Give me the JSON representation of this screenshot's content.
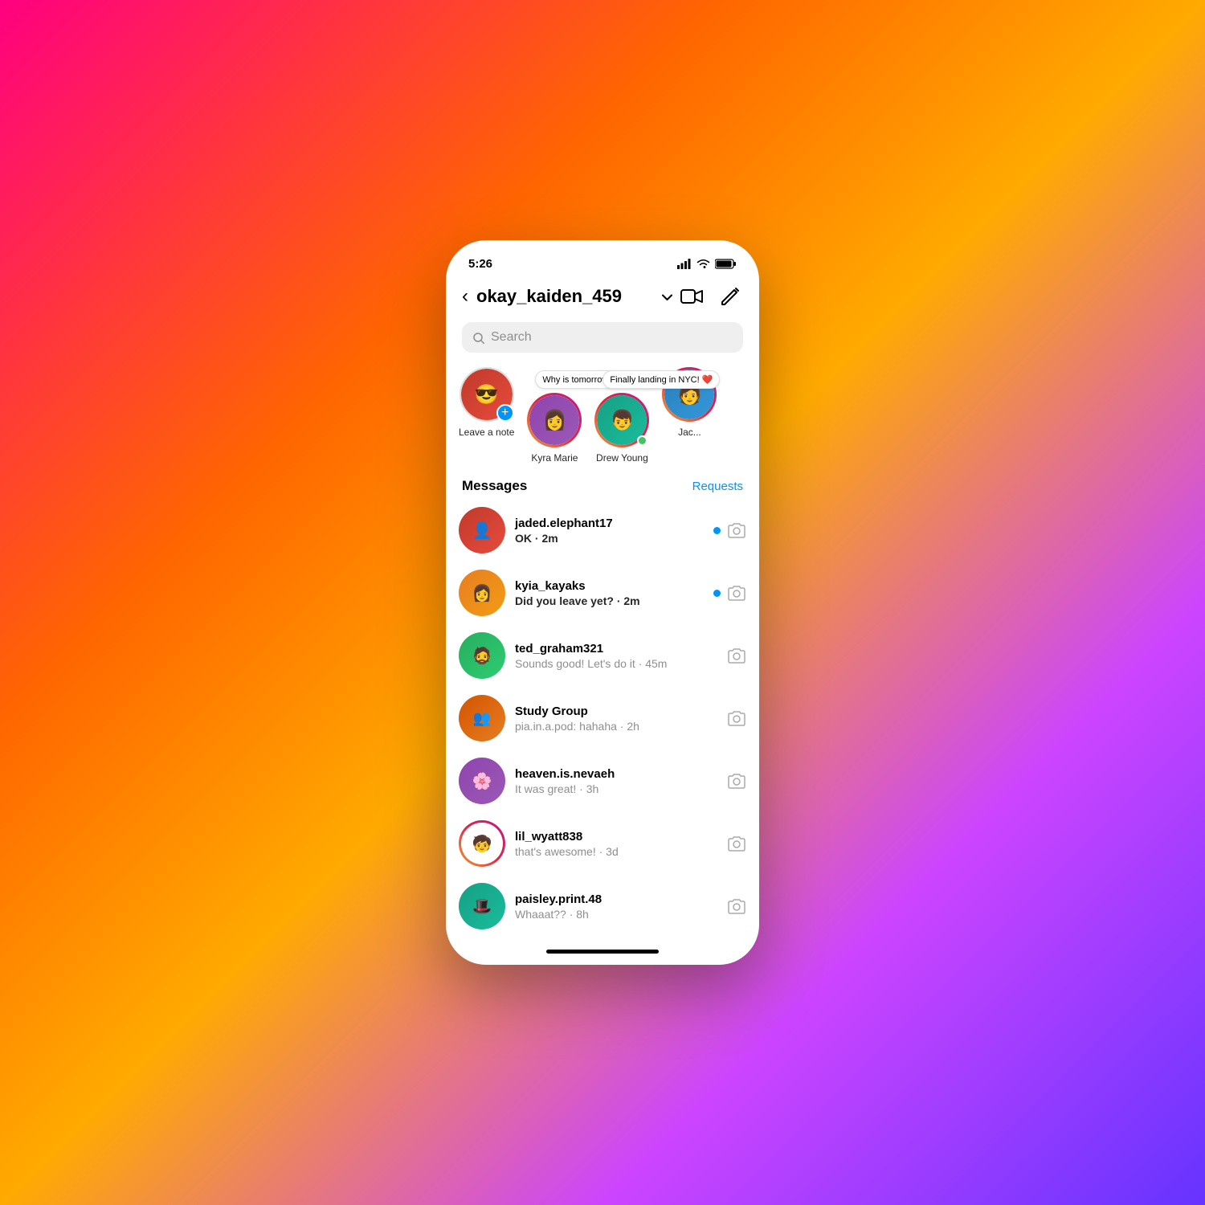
{
  "background": {
    "gradient": "135deg, #ff0080, #ff6600, #ffaa00, #cc44ff, #6633ff"
  },
  "status_bar": {
    "time": "5:26",
    "signal_icon": "signal-icon",
    "wifi_icon": "wifi-icon",
    "battery_icon": "battery-icon"
  },
  "nav": {
    "back_label": "‹",
    "title": "okay_kaiden_459",
    "chevron": "˅",
    "video_icon": "video-camera-icon",
    "compose_icon": "compose-icon"
  },
  "search": {
    "placeholder": "Search"
  },
  "stories": [
    {
      "id": "self",
      "label": "Leave a note",
      "has_add_btn": true,
      "has_note": false,
      "bg_class": "avatar-bg-1"
    },
    {
      "id": "kyra",
      "label": "Kyra Marie",
      "has_add_btn": false,
      "has_note": true,
      "note": "Why is tomorrow Monday!? 🤩",
      "has_gradient": true,
      "bg_class": "avatar-bg-2"
    },
    {
      "id": "drew",
      "label": "Drew Young",
      "has_add_btn": false,
      "has_note": true,
      "note": "Finally landing in NYC! ❤️",
      "has_gradient": true,
      "has_green_dot": true,
      "bg_class": "avatar-bg-3"
    },
    {
      "id": "jack",
      "label": "Jac...",
      "has_add_btn": false,
      "has_note": false,
      "has_gradient": true,
      "bg_class": "avatar-bg-4"
    }
  ],
  "messages_header": {
    "title": "Messages",
    "requests_label": "Requests"
  },
  "messages": [
    {
      "id": "jaded",
      "username": "jaded.elephant17",
      "preview": "OK · 2m",
      "is_unread": true,
      "bg_class": "avatar-bg-1"
    },
    {
      "id": "kyia",
      "username": "kyia_kayaks",
      "preview": "Did you leave yet? · 2m",
      "is_unread": true,
      "bg_class": "avatar-bg-5"
    },
    {
      "id": "ted",
      "username": "ted_graham321",
      "preview": "Sounds good! Let's do it · 45m",
      "is_unread": false,
      "bg_class": "avatar-bg-6"
    },
    {
      "id": "study",
      "username": "Study Group",
      "preview": "pia.in.a.pod: hahaha · 2h",
      "is_unread": false,
      "is_group": true,
      "bg_class": "avatar-bg-7"
    },
    {
      "id": "heaven",
      "username": "heaven.is.nevaeh",
      "preview": "It was great! · 3h",
      "is_unread": false,
      "bg_class": "avatar-bg-2"
    },
    {
      "id": "wyatt",
      "username": "lil_wyatt838",
      "preview": "that's awesome! · 3d",
      "is_unread": false,
      "has_story_ring": true,
      "bg_class": "avatar-bg-8"
    },
    {
      "id": "paisley",
      "username": "paisley.print.48",
      "preview": "Whaaat?? · 8h",
      "is_unread": false,
      "bg_class": "avatar-bg-3"
    }
  ]
}
